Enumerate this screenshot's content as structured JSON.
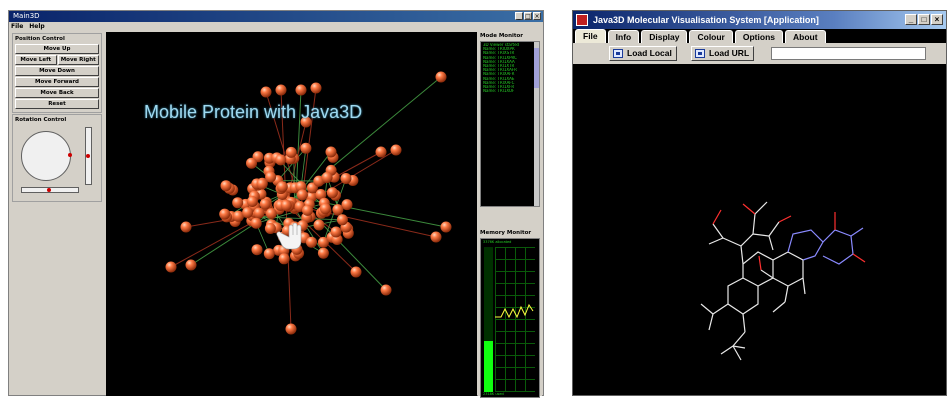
{
  "left_window": {
    "title": "Main3D",
    "menu": [
      "File",
      "Help"
    ],
    "position_control": {
      "title": "Position Control",
      "move_up": "Move Up",
      "move_left": "Move Left",
      "move_right": "Move Right",
      "move_down": "Move Down",
      "move_forward": "Move Forward",
      "move_back": "Move Back",
      "reset": "Reset"
    },
    "rotation_control": {
      "title": "Rotation Control"
    },
    "scene_title": "Mobile Protein with Java3D",
    "mode_monitor": {
      "title": "Mode Monitor",
      "lines": [
        "3D Viewer started",
        "Name: TRIOXPR",
        "Name: TRIXSTR",
        "Name: TRI1XPRC",
        "Name: TRI1XAA",
        "Name: TRI1XTR",
        "Name: TRI1XAFR",
        "Name: TRIXAFR",
        "Name: TRI1XAE",
        "Name: TRIXAFC",
        "Name: TRI1XFR",
        "Name: TRI1XOF"
      ]
    },
    "memory_monitor": {
      "title": "Memory Monitor",
      "allocated_label": "3376K allocated",
      "used_label": "2318K used",
      "usage_fraction": 0.35
    }
  },
  "right_window": {
    "title": "Java3D Molecular Visualisation System [Application]",
    "tabs": [
      "File",
      "Info",
      "Display",
      "Colour",
      "Options",
      "About"
    ],
    "load_local": "Load Local",
    "load_url": "Load URL",
    "url_value": ""
  }
}
